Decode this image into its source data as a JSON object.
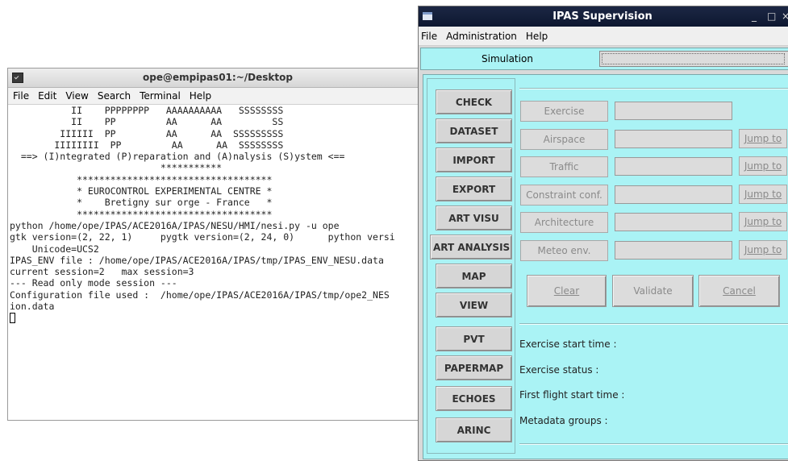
{
  "terminal": {
    "title": "ope@empipas01:~/Desktop",
    "menu": [
      "File",
      "Edit",
      "View",
      "Search",
      "Terminal",
      "Help"
    ],
    "lines": [
      "           II    PPPPPPPP   AAAAAAAAAA   SSSSSSSS",
      "           II    PP         AA      AA         SS",
      "         IIIIII  PP         AA      AA  SSSSSSSSS",
      "        IIIIIIII  PP         AA      AA  SSSSSSSS",
      "",
      "  ==> (I)ntegrated (P)reparation and (A)nalysis (S)ystem <==",
      "                           ***********",
      "",
      "",
      "            ***********************************",
      "            * EUROCONTROL EXPERIMENTAL CENTRE *",
      "            *    Bretigny sur orge - France   *",
      "            ***********************************",
      "",
      "python /home/ope/IPAS/ACE2016A/IPAS/NESU/HMI/nesi.py -u ope",
      "gtk version=(2, 22, 1)     pygtk version=(2, 24, 0)      python versi",
      "    Unicode=UCS2",
      "IPAS_ENV file : /home/ope/IPAS/ACE2016A/IPAS/tmp/IPAS_ENV_NESU.data",
      "current session=2   max session=3",
      "--- Read only mode session ---",
      "",
      "Configuration file used :  /home/ope/IPAS/ACE2016A/IPAS/tmp/ope2_NES",
      "ion.data"
    ]
  },
  "ipas": {
    "title": "IPAS Supervision",
    "window_buttons": {
      "minimize": "_",
      "maximize": "□",
      "close": "×"
    },
    "menu": [
      "File",
      "Administration",
      "Help"
    ],
    "simulation_label": "Simulation",
    "simulation_value": "",
    "nav_buttons": [
      "CHECK",
      "DATASET",
      "IMPORT",
      "EXPORT",
      "ART VISU",
      "ART ANALYSIS",
      "MAP",
      "VIEW",
      "PVT",
      "PAPERMAP",
      "ECHOES",
      "ARINC"
    ],
    "fields": [
      {
        "label": "Exercise",
        "value": "",
        "jump": ""
      },
      {
        "label": "Airspace",
        "value": "",
        "jump": "Jump to"
      },
      {
        "label": "Traffic",
        "value": "",
        "jump": "Jump to"
      },
      {
        "label": "Constraint conf.",
        "value": "",
        "jump": "Jump to"
      },
      {
        "label": "Architecture",
        "value": "",
        "jump": "Jump to"
      },
      {
        "label": "Meteo env.",
        "value": "",
        "jump": "Jump to"
      }
    ],
    "actions": {
      "clear": "Clear",
      "validate": "Validate",
      "cancel": "Cancel"
    },
    "info": {
      "start_time": "Exercise start time :",
      "status": "Exercise status :",
      "first_flight": "First flight start time :",
      "metadata": "Metadata groups :"
    }
  }
}
